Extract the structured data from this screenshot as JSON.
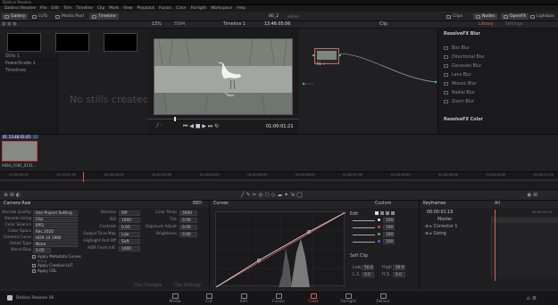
{
  "window_title": "DaVinci Resolve",
  "menu": [
    "DaVinci Resolve",
    "File",
    "Edit",
    "Trim",
    "Timeline",
    "Clip",
    "Mark",
    "View",
    "Playback",
    "Fusion",
    "Color",
    "Fairlight",
    "Workspace",
    "Help"
  ],
  "toolbar": {
    "gallery": "Gallery",
    "luts": "LUTs",
    "media_pool": "Media Pool",
    "timeline": "Timeline",
    "project": "60_2",
    "edited": "Edited",
    "clips": "Clips",
    "nodes": "Nodes",
    "openfx": "OpenFX",
    "lightbox": "Lightbox"
  },
  "viewer_bar": {
    "zoom": "13%",
    "clip_name": "5594",
    "timeline_name": "Timeline 1",
    "timecode": "13:46:05:06",
    "mode": "Clip"
  },
  "library": {
    "tab_library": "Library",
    "tab_settings": "Settings",
    "section_blur": "ResolveFX Blur",
    "items": [
      "Box Blur",
      "Directional Blur",
      "Gaussian Blur",
      "Lens Blur",
      "Mosaic Blur",
      "Radial Blur",
      "Zoom Blur"
    ],
    "section_color": "ResolveFX Color"
  },
  "gallery": {
    "stills_label": "Stills 1",
    "powergrade": "PowerGrade 1",
    "timelines": "Timelines",
    "empty_message": "No stills created"
  },
  "viewer": {
    "timecode": "01:00:01:21"
  },
  "node": {
    "label": "01 ✓"
  },
  "clip": {
    "number": "01",
    "timecode": "13:46:03:45",
    "track": "V1",
    "name": "A064_C081_0131..."
  },
  "ruler": {
    "marks": [
      "01:00:00:00",
      "01:00:01:00",
      "01:00:02:00",
      "01:00:03:00",
      "01:00:04:00",
      "01:00:05:00",
      "01:00:06:00",
      "01:00:07:00",
      "01:00:08:00",
      "01:00:09:00",
      "01:00:10:00",
      "01:00:11:00"
    ]
  },
  "camera_raw": {
    "title": "Camera Raw",
    "mode": "RED",
    "left_labels": [
      "Decode Quality",
      "Decode Using",
      "Color Science",
      "Color Space",
      "Gamma Curve",
      "Detail Type",
      "Blend Bias"
    ],
    "left_values": [
      "Use Project Setting",
      "Clip",
      "IPP2",
      "Rec.2020",
      "HDR 14 1984",
      "None",
      "0.00"
    ],
    "checks": [
      "Apply Metadata Curves",
      "Apply Creative LUT",
      "Apply CDL"
    ],
    "check_sub": "R.E.D.",
    "mid_labels": [
      "Denoise",
      "ISO",
      "Contrast",
      "Output Tone Map",
      "Highlight Roll-Off",
      "HDR Flash Infl."
    ],
    "mid_values": [
      "Off",
      "1000",
      "0.00",
      "Low",
      "Soft",
      "1000"
    ],
    "right_labels": [
      "Color Temp",
      "Tint",
      "Exposure Adjust",
      "Brightness"
    ],
    "right_values": [
      "5600",
      "0.00",
      "0.00",
      "0.00"
    ],
    "use_changes": "Use Changes",
    "use_settings": "Use Settings"
  },
  "curves": {
    "title": "Curves",
    "mode": "Custom",
    "edit": "Edit",
    "soft_clip": "Soft Clip",
    "low": "Low",
    "low_v": "50.0",
    "high": "High",
    "high_v": "50.0",
    "ls": "L.S.",
    "ls_v": "0.0",
    "hs": "H.S.",
    "hs_v": "0.0",
    "edit_values": [
      "100",
      "100",
      "100",
      "100"
    ]
  },
  "keyframes": {
    "title": "Keyframes",
    "filter": "All",
    "timecode": "00:00:01:19",
    "time2": "00:00:00:00",
    "master": "Master",
    "corrector": "Corrector 1",
    "sizing": "Sizing"
  },
  "pages": [
    "Media",
    "Cut",
    "Edit",
    "Fusion",
    "Color",
    "Fairlight",
    "Deliver"
  ],
  "app_brand": "DaVinci Resolve 16",
  "colors": {
    "accent": "#e05a5a",
    "bg": "#1c1c1e"
  }
}
